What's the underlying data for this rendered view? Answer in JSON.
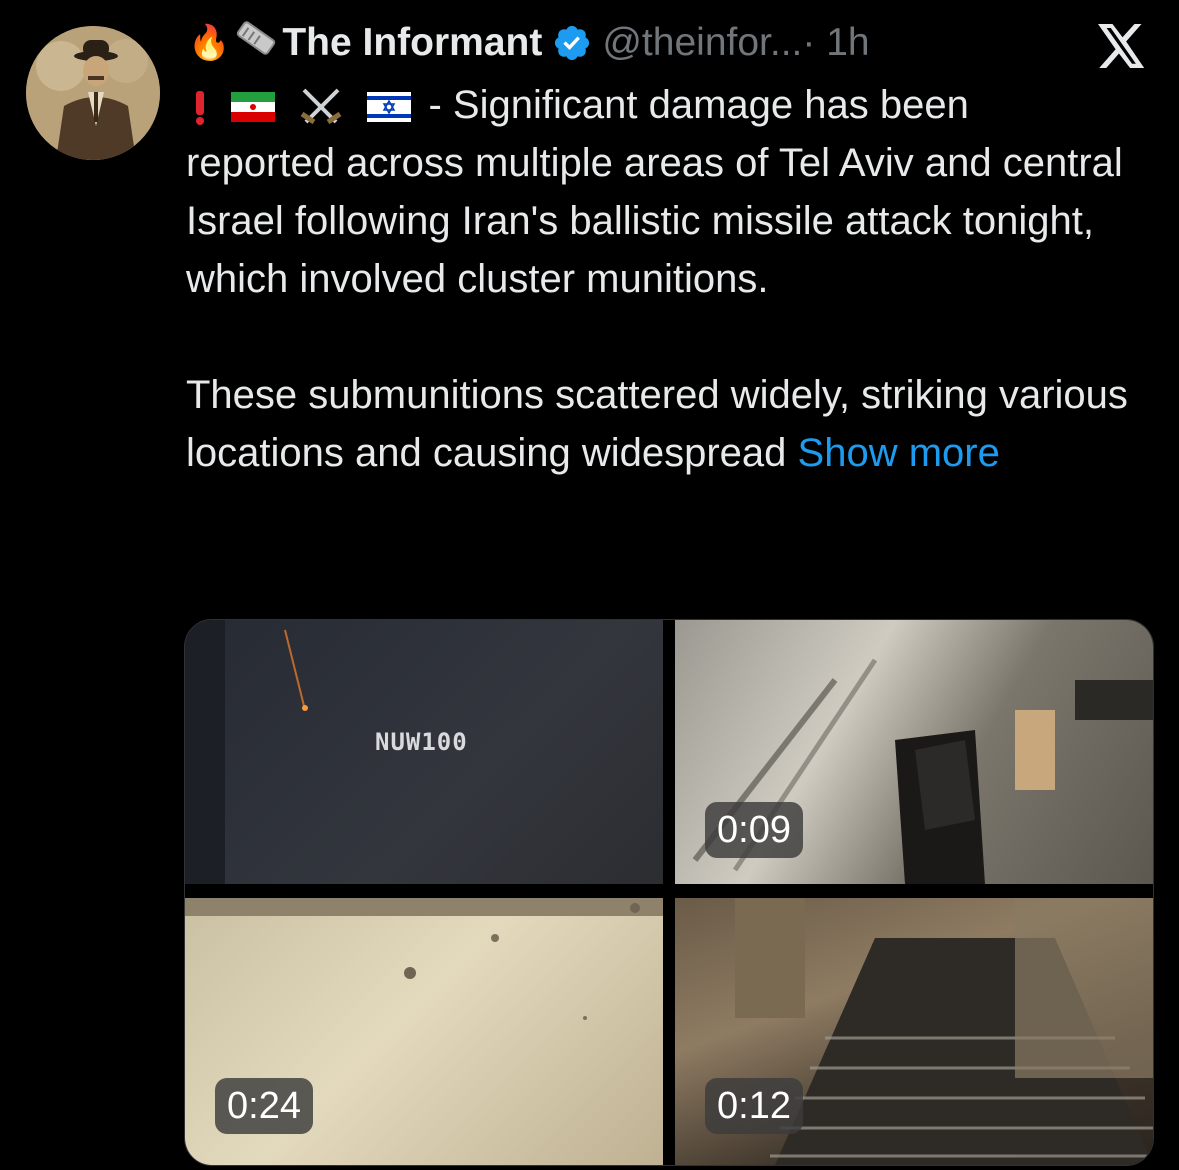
{
  "tweet": {
    "author_name": "The Informant",
    "handle": "@theinfor...",
    "time": " · 1h",
    "prefix_emojis": "🔥🗞",
    "line1_text": " - Significant damage has been",
    "paragraph1_rest": "reported across multiple areas of Tel Aviv and central Israel following Iran's ballistic missile attack tonight, which involved cluster munitions.",
    "paragraph2": "These submunitions scattered widely, striking various locations and causing widespread ",
    "show_more": "Show more"
  },
  "media": {
    "videos": [
      {
        "watermark": "NUW100",
        "duration": ""
      },
      {
        "duration": "0:09"
      },
      {
        "duration": "0:24"
      },
      {
        "duration": "0:12"
      }
    ]
  },
  "colors": {
    "background": "#000000",
    "text": "#e7e9ea",
    "secondary": "#71767b",
    "link": "#1d9bf0",
    "verified": "#1d9bf0"
  },
  "icons": [
    "avatar",
    "fire-emoji-icon",
    "newspaper-emoji-icon",
    "exclamation-icon",
    "iran-flag-icon",
    "crossed-swords-icon",
    "israel-flag-icon",
    "verified-badge-icon",
    "x-logo-icon"
  ]
}
